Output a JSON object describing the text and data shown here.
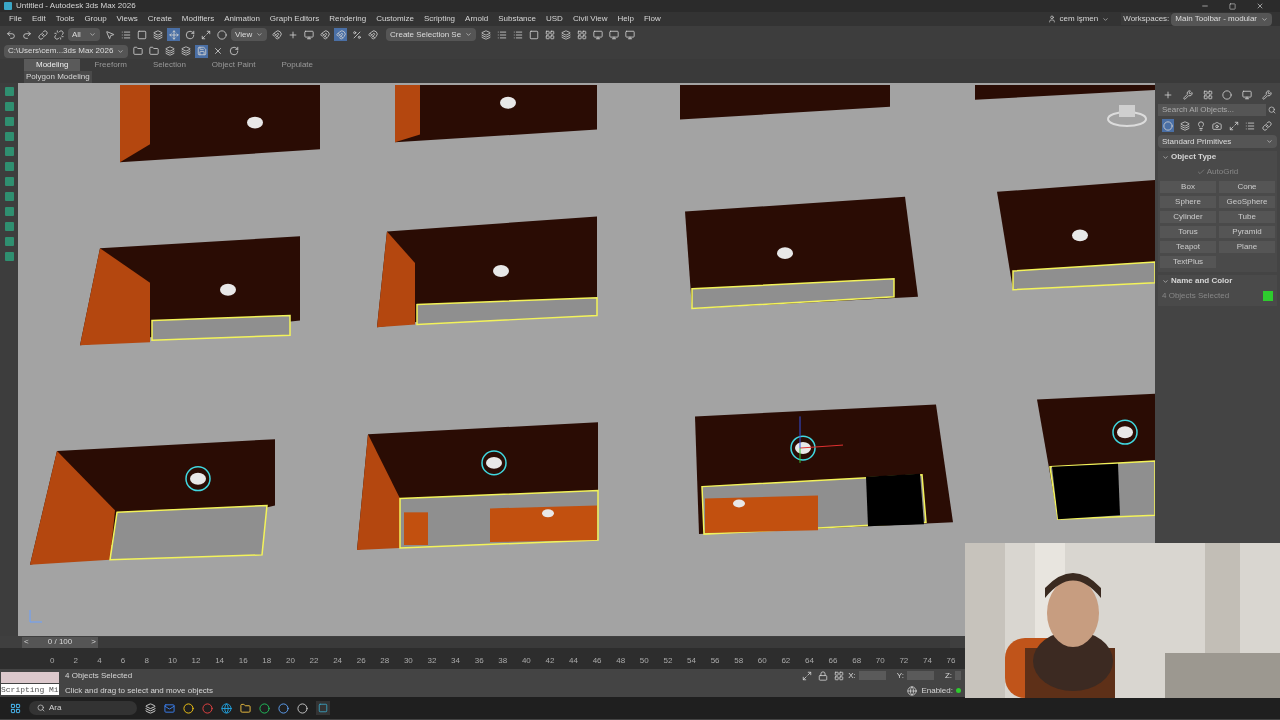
{
  "window": {
    "title": "Untitled - Autodesk 3ds Max 2026"
  },
  "menu": [
    "File",
    "Edit",
    "Tools",
    "Group",
    "Views",
    "Create",
    "Modifiers",
    "Animation",
    "Graph Editors",
    "Rendering",
    "Customize",
    "Scripting",
    "Arnold",
    "Substance",
    "USD",
    "Civil View",
    "Help",
    "Flow"
  ],
  "account": {
    "user": "cem işmen",
    "workspaces_label": "Workspaces:",
    "workspace": "Main Toolbar - modular"
  },
  "toolbar": {
    "selection_filter": "All",
    "reference_coord": "View",
    "named_selection": "Create Selection Se",
    "project_path": "C:\\Users\\cem...3ds Max 2026"
  },
  "ribbon": {
    "tabs": [
      {
        "label": "Modeling",
        "selected": true
      },
      {
        "label": "Freeform",
        "selected": false
      },
      {
        "label": "Selection",
        "selected": false
      },
      {
        "label": "Object Paint",
        "selected": false
      },
      {
        "label": "Populate",
        "selected": false
      }
    ],
    "panel": "Polygon Modeling"
  },
  "command_panel": {
    "search": {
      "placeholder": "Search All Objects..."
    },
    "category": "Standard Primitives",
    "object_type": {
      "title": "Object Type",
      "expanded": true,
      "autogrid": {
        "label": "AutoGrid",
        "checked": true
      },
      "buttons": [
        "Box",
        "Cone",
        "Sphere",
        "GeoSphere",
        "Cylinder",
        "Tube",
        "Torus",
        "Pyramid",
        "Teapot",
        "Plane",
        "TextPlus"
      ]
    },
    "name_and_color": {
      "title": "Name and Color",
      "expanded": true,
      "name": "4 Objects Selected",
      "color": "#2ecc2e"
    }
  },
  "timeline": {
    "slider": {
      "label": "0 / 100",
      "prev": "<",
      "next": ">",
      "level": 0
    },
    "ticks": [
      "0",
      "2",
      "4",
      "6",
      "8",
      "10",
      "12",
      "14",
      "16",
      "18",
      "20",
      "22",
      "24",
      "26",
      "28",
      "30",
      "32",
      "34",
      "36",
      "38",
      "40",
      "42",
      "44",
      "46",
      "48",
      "50",
      "52",
      "54",
      "56",
      "58",
      "60",
      "62",
      "64",
      "66",
      "68",
      "70",
      "72",
      "74",
      "76"
    ]
  },
  "status": {
    "listener": "Scripting Mi",
    "selection": "4 Objects Selected",
    "prompt": "Click and drag to select and move objects",
    "x_label": "X:",
    "y_label": "Y:",
    "z_label": "Z:",
    "enabled_label": "Enabled:"
  },
  "taskbar": {
    "search": "Ara"
  }
}
